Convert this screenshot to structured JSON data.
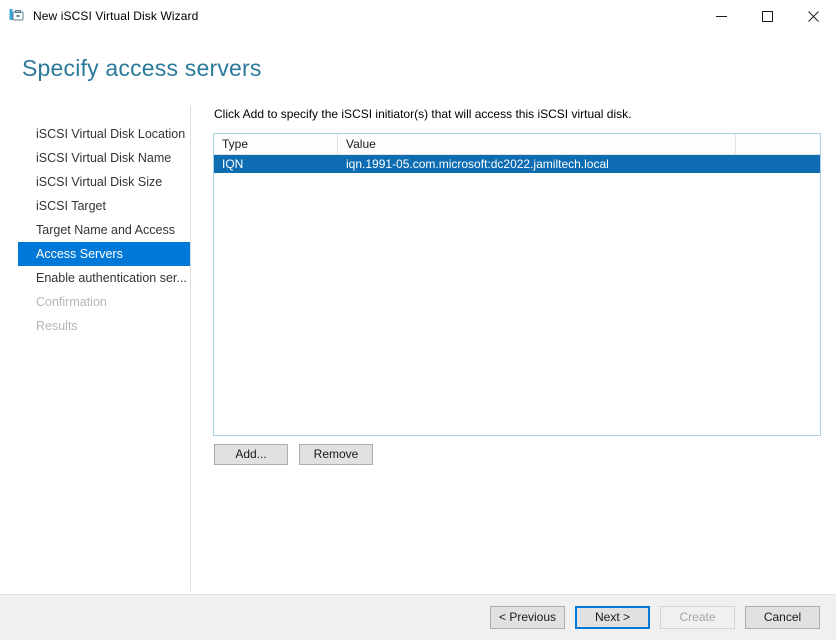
{
  "window": {
    "title": "New iSCSI Virtual Disk Wizard",
    "icon": "iscsi-disk-icon",
    "controls": {
      "minimize": "minimize-icon",
      "maximize": "maximize-icon",
      "close": "close-icon"
    }
  },
  "heading": "Specify access servers",
  "accent_color": "#2a7a9b",
  "selection_color": "#0078d7",
  "nav": {
    "items": [
      {
        "label": "iSCSI Virtual Disk Location",
        "state": "done"
      },
      {
        "label": "iSCSI Virtual Disk Name",
        "state": "done"
      },
      {
        "label": "iSCSI Virtual Disk Size",
        "state": "done"
      },
      {
        "label": "iSCSI Target",
        "state": "done"
      },
      {
        "label": "Target Name and Access",
        "state": "done"
      },
      {
        "label": "Access Servers",
        "state": "selected"
      },
      {
        "label": "Enable authentication ser...",
        "state": "done"
      },
      {
        "label": "Confirmation",
        "state": "disabled"
      },
      {
        "label": "Results",
        "state": "disabled"
      }
    ]
  },
  "main": {
    "instruction": "Click Add to specify the iSCSI initiator(s) that will access this iSCSI virtual disk.",
    "table": {
      "columns": [
        "Type",
        "Value",
        ""
      ],
      "rows": [
        {
          "type": "IQN",
          "value": "iqn.1991-05.com.microsoft:dc2022.jamiltech.local",
          "selected": true
        }
      ]
    },
    "buttons": {
      "add": "Add...",
      "remove": "Remove"
    }
  },
  "footer": {
    "previous": "< Previous",
    "next": "Next >",
    "create": "Create",
    "cancel": "Cancel"
  }
}
